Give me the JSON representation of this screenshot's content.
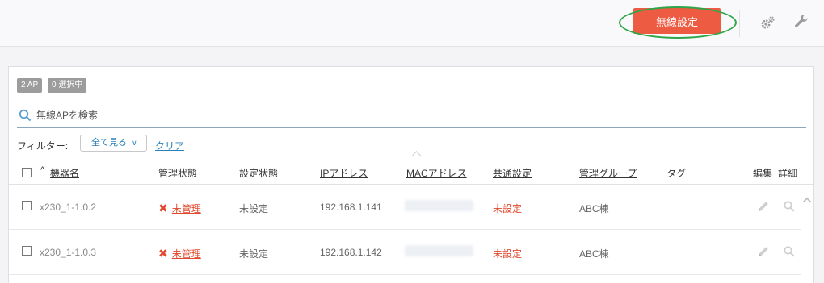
{
  "header": {
    "wireless_button_label": "無線設定",
    "settings_icon": "gears-icon",
    "tools_icon": "wrench-icon"
  },
  "summary": {
    "ap_count": "2 AP",
    "selected_count": "0 選択中"
  },
  "search": {
    "placeholder": "無線APを検索"
  },
  "filter": {
    "label": "フィルター:",
    "selected": "全て見る",
    "clear_label": "クリア"
  },
  "table": {
    "columns": {
      "name": "機器名",
      "management": "管理状態",
      "config": "設定状態",
      "ip": "IPアドレス",
      "mac": "MACアドレス",
      "common": "共通設定",
      "group": "管理グループ",
      "tag": "タグ",
      "edit": "編集",
      "details": "詳細"
    },
    "sort_indicator": "^",
    "rows": [
      {
        "name": "x230_1-1.0.2",
        "management": "未管理",
        "config": "未設定",
        "ip": "192.168.1.141",
        "common": "未設定",
        "group": "ABC棟",
        "tag": ""
      },
      {
        "name": "x230_1-1.0.3",
        "management": "未管理",
        "config": "未設定",
        "ip": "192.168.1.142",
        "common": "未設定",
        "group": "ABC棟",
        "tag": ""
      }
    ]
  },
  "colors": {
    "accent": "#ee5b43",
    "link": "#2b7fb8",
    "error": "#e04a2f",
    "highlight": "#2fa64a"
  }
}
